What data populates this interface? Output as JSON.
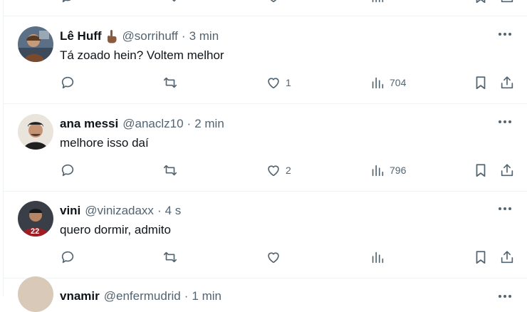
{
  "tweets": [
    {
      "name": "Lê Huff",
      "handle": "@sorrihuff",
      "sep": "·",
      "time": "3 min",
      "text": "Tá zoado hein? Voltem melhor",
      "replies": "",
      "retweets": "",
      "likes": "1",
      "views": "704",
      "has_emoji": true
    },
    {
      "name": "ana messi",
      "handle": "@anaclz10",
      "sep": "·",
      "time": "2 min",
      "text": "melhore isso daí",
      "replies": "",
      "retweets": "",
      "likes": "2",
      "views": "796",
      "has_emoji": false
    },
    {
      "name": "vini",
      "handle": "@vinizadaxx",
      "sep": "·",
      "time": "4 s",
      "text": "quero dormir, admito",
      "replies": "",
      "retweets": "",
      "likes": "",
      "views": "",
      "has_emoji": false
    }
  ],
  "next_partial": {
    "name": "vnamir",
    "handle": "@enfermudrid",
    "sep": "·",
    "time": "1 min"
  },
  "colors": {
    "text": "#0f1419",
    "muted": "#536471",
    "divider": "#eff3f4"
  },
  "icons": [
    "reply-icon",
    "retweet-icon",
    "like-icon",
    "views-icon",
    "bookmark-icon",
    "share-icon",
    "more-icon",
    "middle-finger-emoji"
  ]
}
